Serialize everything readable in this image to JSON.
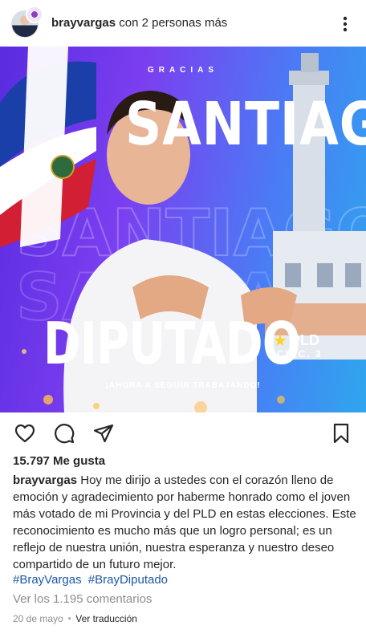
{
  "header": {
    "username": "brayvargas",
    "collab_text": "con 2 personas más",
    "more_icon": "more-vertical-icon"
  },
  "image": {
    "gracias": "GRACIAS",
    "big_name": "SANTIAGO",
    "title": "DIPUTADO",
    "party": "PLD",
    "circ": "CIRC. 3",
    "slogan": "¡AHORA A SEGUIR TRABAJANDO!"
  },
  "actions": {
    "like_icon": "heart-icon",
    "comment_icon": "comment-icon",
    "share_icon": "send-icon",
    "save_icon": "bookmark-icon"
  },
  "likes": "15.797 Me gusta",
  "caption": {
    "username": "brayvargas",
    "text": "Hoy me dirijo a ustedes con el corazón lleno de emoción y agradecimiento por haberme honrado como el joven más votado de mi Provincia y del PLD  en estas elecciones. Este reconocimiento es mucho más que un logro personal; es un reflejo de nuestra unión, nuestra esperanza y nuestro deseo compartido de un futuro mejor."
  },
  "hashtags": [
    "#BrayVargas",
    "#BrayDiputado"
  ],
  "view_comments": "Ver los 1.195 comentarios",
  "date": "20 de mayo",
  "separator": "•",
  "translate": "Ver traducción",
  "colors": {
    "text": "#262626",
    "muted": "#8e8e8e",
    "link": "#1d57a8",
    "image_purple": "#7b3ff0",
    "image_blue": "#2fa6ee",
    "star": "#ffd21f"
  }
}
